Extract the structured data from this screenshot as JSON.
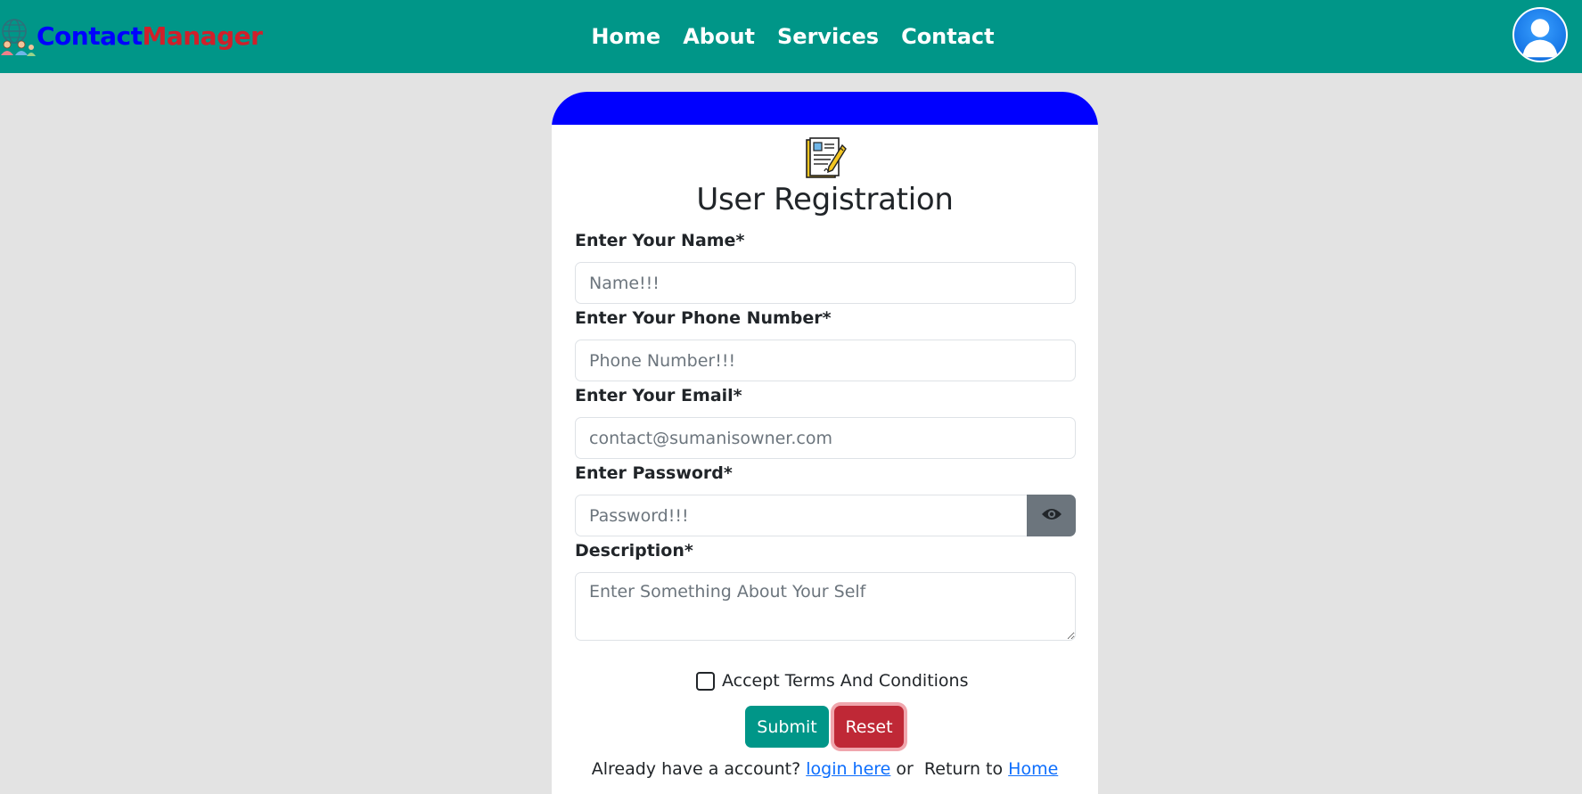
{
  "navbar": {
    "brand_part1": "Contact",
    "brand_part2": "Manager",
    "links": [
      "Home",
      "About",
      "Services",
      "Contact"
    ],
    "bg_color": "#009688"
  },
  "form": {
    "icon": "registration-form-icon",
    "title": "User Registration",
    "name_label": "Enter Your Name*",
    "name_placeholder": "Name!!!",
    "phone_label": "Enter Your Phone Number*",
    "phone_placeholder": "Phone Number!!!",
    "email_label": "Enter Your Email*",
    "email_placeholder": "contact@sumanisowner.com",
    "password_label": "Enter Password*",
    "password_placeholder": "Password!!!",
    "password_toggle_icon": "eye-icon",
    "description_label": "Description*",
    "description_placeholder": "Enter Something About Your Self",
    "terms_label": "Accept Terms And Conditions",
    "terms_checked": false,
    "submit_label": "Submit",
    "reset_label": "Reset",
    "footer_text1": "Already have a account?",
    "footer_login_link": "login here",
    "footer_text2": "or  Return to",
    "footer_home_link": "Home"
  },
  "colors": {
    "header_band": "#0000ff",
    "submit": "#009688",
    "reset": "#bf2836",
    "link": "#0d6efd"
  }
}
